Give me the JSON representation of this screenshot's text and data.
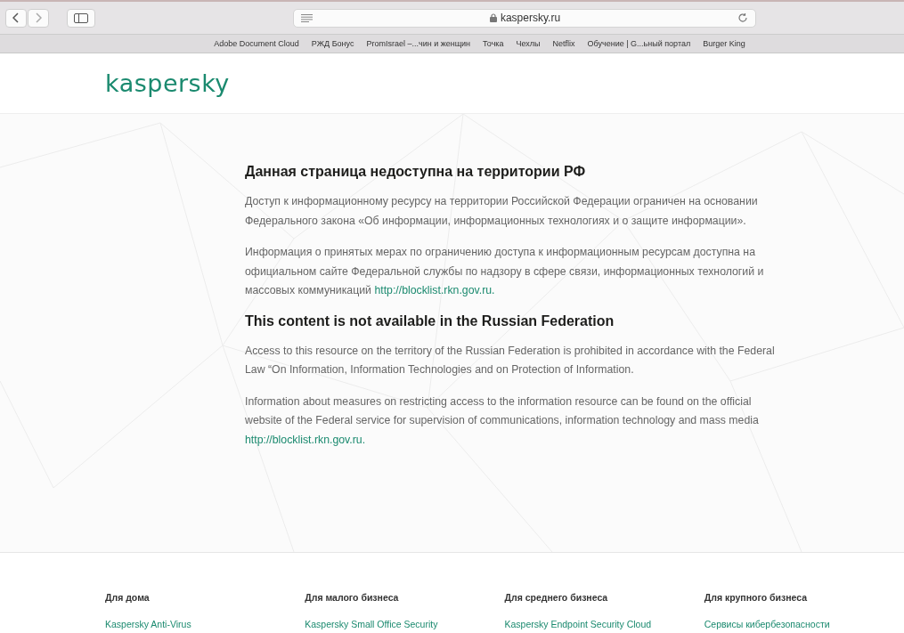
{
  "browser": {
    "address": "kaspersky.ru",
    "bookmarks": [
      "Adobe Document Cloud",
      "РЖД Бонус",
      "PromIsrael –...чин и женщин",
      "Точка",
      "Чехлы",
      "Netflix",
      "Обучение | G...ьный портал",
      "Burger King"
    ]
  },
  "header": {
    "logo": "kaspersky"
  },
  "sections": [
    {
      "heading": "Данная страница недоступна на территории РФ",
      "paragraphs": [
        {
          "text": "Доступ к информационному ресурсу на территории Российской Федерации ограничен на основании Федерального закона «Об информации, информационных технологиях и о защите информации»."
        },
        {
          "text": "Информация о принятых мерах по ограничению доступа к информационным ресурсам доступна на официальном сайте Федеральной службы по надзору в сфере связи, информационных технологий и массовых коммуникаций ",
          "link": "http://blocklist.rkn.gov.ru."
        }
      ]
    },
    {
      "heading": "This content is not available in the Russian Federation",
      "paragraphs": [
        {
          "text": "Access to this resource on the territory of the Russian Federation is prohibited in accordance with the Federal Law “On Information, Information Technologies and on Protection of Information."
        },
        {
          "text": "Information about measures on restricting access to the information resource can be found on the official website of the Federal service for supervision of communications, information technology and mass media ",
          "link": "http://blocklist.rkn.gov.ru."
        }
      ]
    }
  ],
  "footer": {
    "columns": [
      {
        "heading": "Для дома",
        "link": "Kaspersky Anti-Virus"
      },
      {
        "heading": "Для малого бизнеса",
        "link": "Kaspersky Small Office Security"
      },
      {
        "heading": "Для среднего бизнеса",
        "link": "Kaspersky Endpoint Security Cloud"
      },
      {
        "heading": "Для крупного бизнеса",
        "link": "Сервисы кибербезопасности"
      }
    ]
  }
}
